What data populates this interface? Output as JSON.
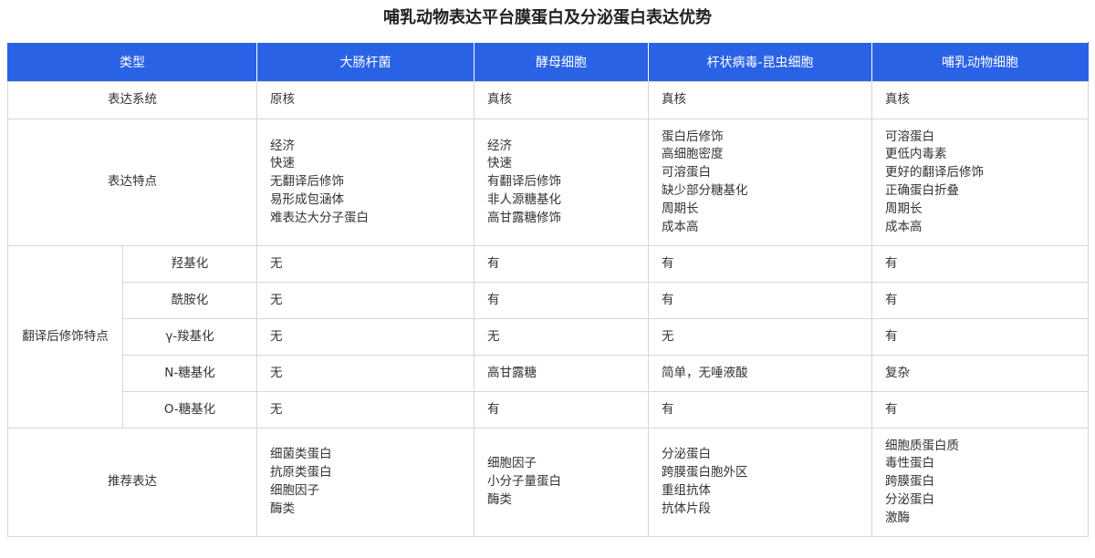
{
  "title": "哺乳动物表达平台膜蛋白及分泌蛋白表达优势",
  "headers": [
    "类型",
    "大肠杆菌",
    "酵母细胞",
    "杆状病毒-昆虫细胞",
    "哺乳动物细胞"
  ],
  "expression_system": {
    "label": "表达系统",
    "values": [
      "原核",
      "真核",
      "真核",
      "真核"
    ]
  },
  "expression_features": {
    "label": "表达特点",
    "values": [
      [
        "经济",
        "快速",
        "无翻译后修饰",
        "易形成包涵体",
        "难表达大分子蛋白"
      ],
      [
        "经济",
        "快速",
        "有翻译后修饰",
        "非人源糖基化",
        "高甘露糖修饰"
      ],
      [
        "蛋白后修饰",
        "高细胞密度",
        "可溶蛋白",
        "缺少部分糖基化",
        "周期长",
        "成本高"
      ],
      [
        "可溶蛋白",
        "更低内毒素",
        "更好的翻译后修饰",
        "正确蛋白折叠",
        "周期长",
        "成本高"
      ]
    ]
  },
  "ptm": {
    "label": "翻译后修饰特点",
    "rows": [
      {
        "name": "羟基化",
        "values": [
          "无",
          "有",
          "有",
          "有"
        ]
      },
      {
        "name": "酰胺化",
        "values": [
          "无",
          "有",
          "有",
          "有"
        ]
      },
      {
        "name": "γ-羧基化",
        "values": [
          "无",
          "无",
          "无",
          "有"
        ]
      },
      {
        "name": "N-糖基化",
        "values": [
          "无",
          "高甘露糖",
          "简单，无唾液酸",
          "复杂"
        ]
      },
      {
        "name": "O-糖基化",
        "values": [
          "无",
          "有",
          "有",
          "有"
        ]
      }
    ]
  },
  "recommended": {
    "label": "推荐表达",
    "values": [
      [
        "细菌类蛋白",
        "抗原类蛋白",
        "细胞因子",
        "酶类"
      ],
      [
        "细胞因子",
        "小分子量蛋白",
        "酶类"
      ],
      [
        "分泌蛋白",
        "跨膜蛋白胞外区",
        "重组抗体",
        "抗体片段"
      ],
      [
        "细胞质蛋白质",
        "毒性蛋白",
        "跨膜蛋白",
        "分泌蛋白",
        "激酶"
      ]
    ]
  },
  "colors": {
    "header_bg": "#2a62e6",
    "header_text": "#ffffff",
    "border": "#d7d7d7"
  }
}
